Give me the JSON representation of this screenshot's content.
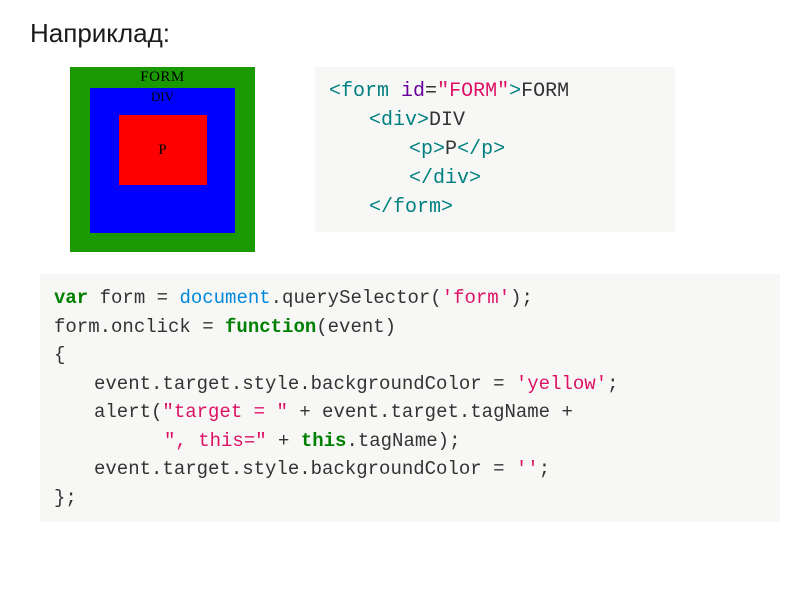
{
  "heading": "Наприклад:",
  "diagram": {
    "form_label": "FORM",
    "div_label": "DIV",
    "p_label": "P"
  },
  "code1": {
    "l1_open": "<",
    "l1_tag": "form",
    "l1_attr": " id",
    "l1_eq": "=",
    "l1_val": "\"FORM\"",
    "l1_close": ">",
    "l1_text": "FORM",
    "l2_open": "<",
    "l2_tag": "div",
    "l2_close": ">",
    "l2_text": "DIV",
    "l3_open": "<",
    "l3_tag": "p",
    "l3_close": ">",
    "l3_text": "P",
    "l3_c_open": "</",
    "l3_c_tag": "p",
    "l3_c_close": ">",
    "l4_c_open": "</",
    "l4_c_tag": "div",
    "l4_c_close": ">",
    "l5_c_open": "</",
    "l5_c_tag": "form",
    "l5_c_close": ">"
  },
  "code2": {
    "l1_kw": "var",
    "l1_a": " form = ",
    "l1_b1": "document",
    "l1_b2": ".querySelector(",
    "l1_str": "'form'",
    "l1_b3": ");",
    "l2_a": "form.onclick = ",
    "l2_kw": "function",
    "l2_b": "(event)",
    "l3": "{",
    "l4_a": "event.target.style.backgroundColor = ",
    "l4_str": "'yellow'",
    "l4_b": ";",
    "l5_a": "alert(",
    "l5_str1": "\"target = \"",
    "l5_b": " + event.target.tagName +",
    "l6_str": "\", this=\"",
    "l6_a": " + ",
    "l6_kw": "this",
    "l6_b": ".tagName);",
    "l7_a": "event.target.style.backgroundColor = ",
    "l7_str": "''",
    "l7_b": ";",
    "l8": "};"
  }
}
